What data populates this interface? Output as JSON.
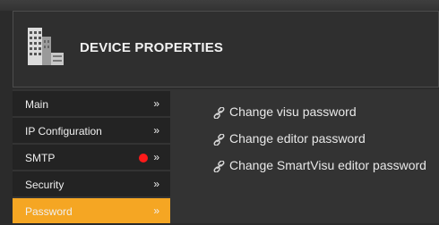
{
  "header": {
    "title": "DEVICE PROPERTIES",
    "logo_icon": "building-icon"
  },
  "sidebar": {
    "items": [
      {
        "label": "Main",
        "arrow": "»",
        "active": false
      },
      {
        "label": "IP Configuration",
        "arrow": "»",
        "active": false
      },
      {
        "label": "SMTP",
        "arrow": "»",
        "active": false,
        "status_indicator": "red-dot"
      },
      {
        "label": "Security",
        "arrow": "»",
        "active": false
      },
      {
        "label": "Password",
        "arrow": "»",
        "active": true
      }
    ]
  },
  "links": [
    {
      "label": "Change visu password",
      "icon": "link-icon"
    },
    {
      "label": "Change editor password",
      "icon": "link-icon"
    },
    {
      "label": "Change SmartVisu editor password",
      "icon": "link-icon"
    }
  ],
  "colors": {
    "accent": "#f5a623",
    "status_dot": "#ff1a1a",
    "sidebar_bg": "#232323",
    "content_bg": "#333333"
  }
}
